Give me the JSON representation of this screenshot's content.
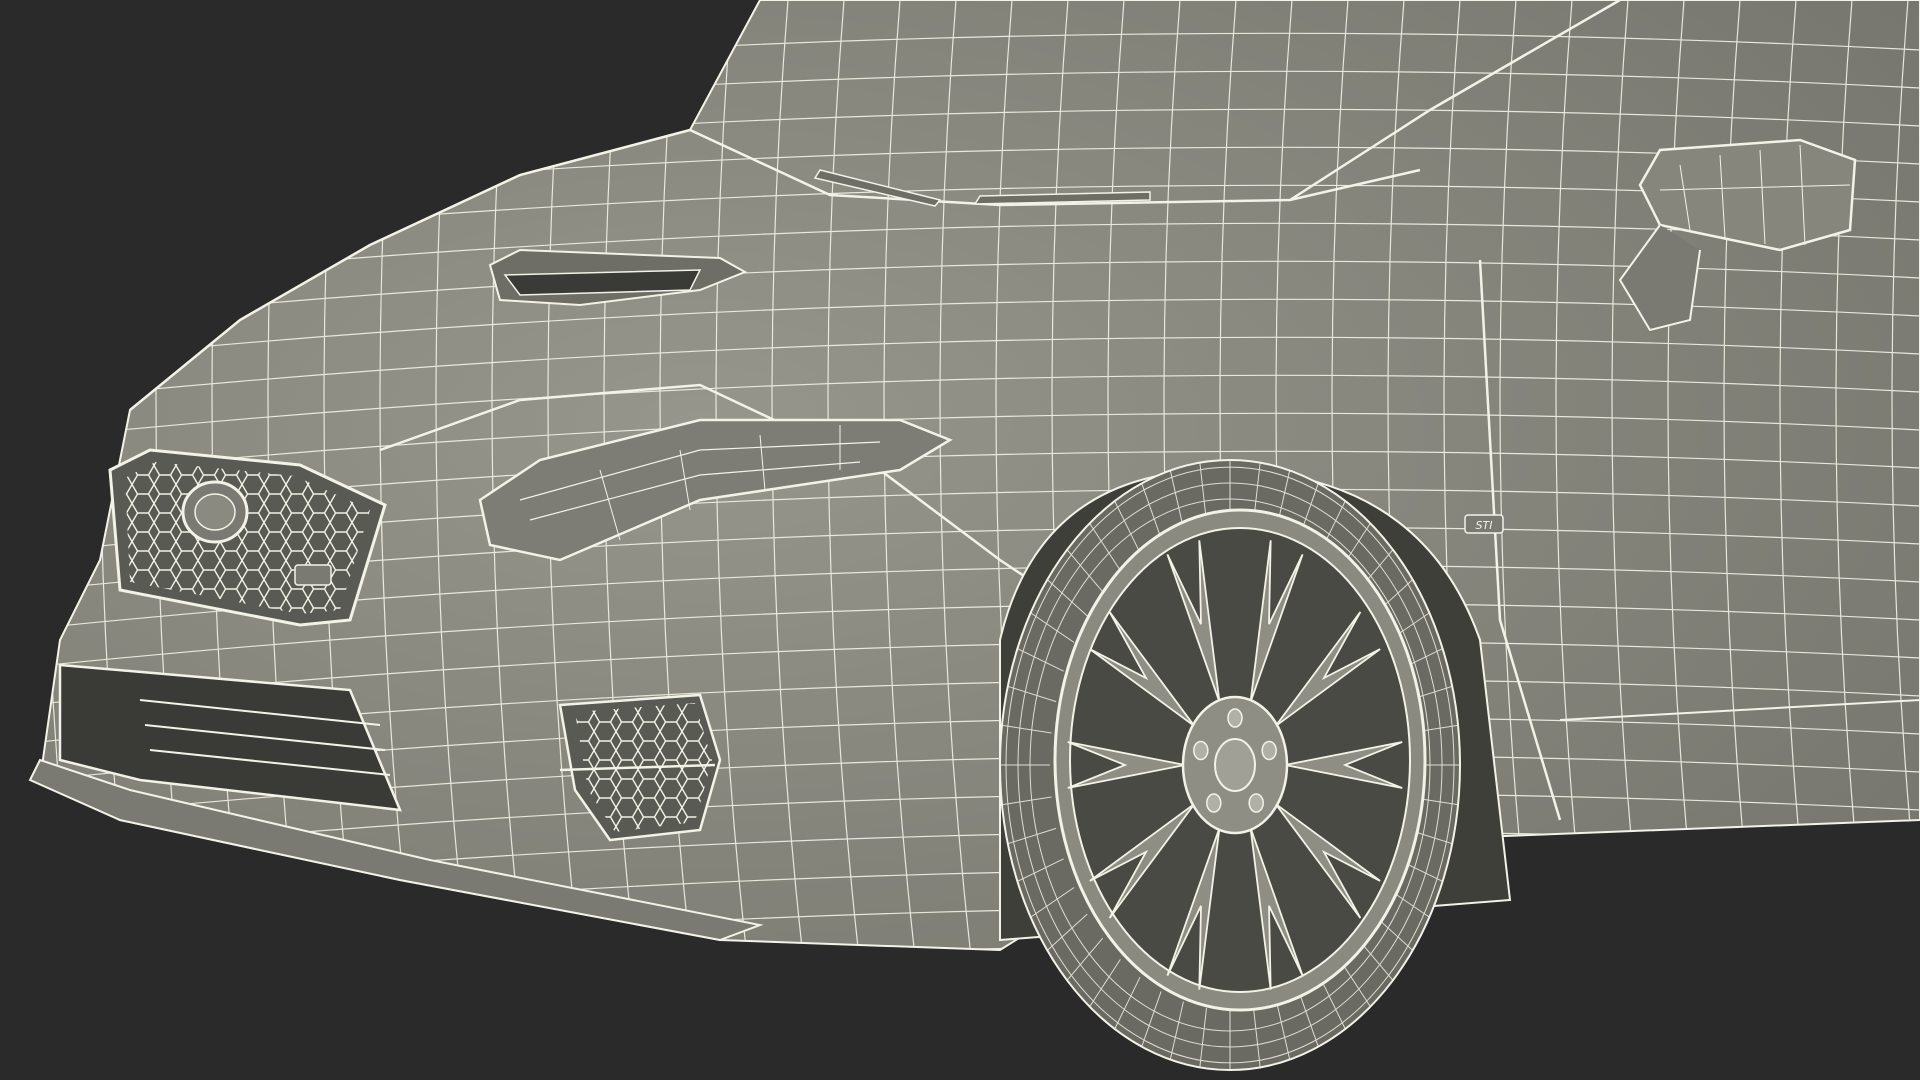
{
  "scene": {
    "subject": "car-front-quarter-wireframe",
    "background_color": "#2a2a2a",
    "body_color": "#8a8a80",
    "body_shadow_color": "#6e6e66",
    "wire_color": "#f2f2e6",
    "dark_opening_color": "#3a3a36",
    "badge_text": "STI"
  }
}
